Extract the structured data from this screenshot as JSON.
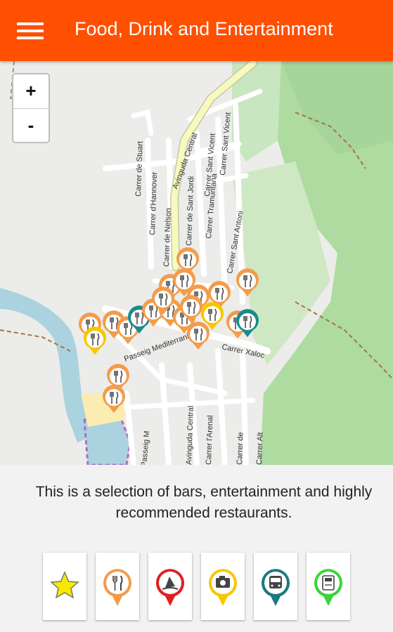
{
  "header": {
    "title": "Food, Drink and Entertainment",
    "menu_icon": "hamburger-menu-icon"
  },
  "map": {
    "zoom_in_label": "+",
    "zoom_out_label": "-",
    "streets": [
      "Avinguda Central",
      "Carrer de Stuart",
      "Carrer d'Hannover",
      "Carrer de Nelson",
      "Carrer de Sant Jordi",
      "Carrer Tramuntana",
      "Carrer Sant Vicent",
      "Carrer Sant Vicent",
      "Carrer Sant Antoni",
      "Carrer Xaloc",
      "Passeig Mediterrani",
      "Passeig M",
      "Avinguda Central",
      "Carrer l'Arenal",
      "Carrer de",
      "Carrer Alt"
    ],
    "colors": {
      "restaurant": "#f39c4a",
      "entertainment": "#f6c700",
      "bus": "#1b8a8a"
    }
  },
  "description": "This is a selection of bars, entertainment and highly recommended restaurants.",
  "categories": [
    {
      "name": "favorites",
      "icon": "star-icon",
      "color": "#f6e900"
    },
    {
      "name": "restaurants",
      "icon": "fork-knife-icon",
      "color": "#f39c4a"
    },
    {
      "name": "activities",
      "icon": "windsurf-icon",
      "color": "#e02020"
    },
    {
      "name": "photo",
      "icon": "camera-icon",
      "color": "#f6c700"
    },
    {
      "name": "transport",
      "icon": "bus-icon",
      "color": "#1b7a80"
    },
    {
      "name": "atm",
      "icon": "atm-icon",
      "color": "#3ad43a"
    }
  ]
}
